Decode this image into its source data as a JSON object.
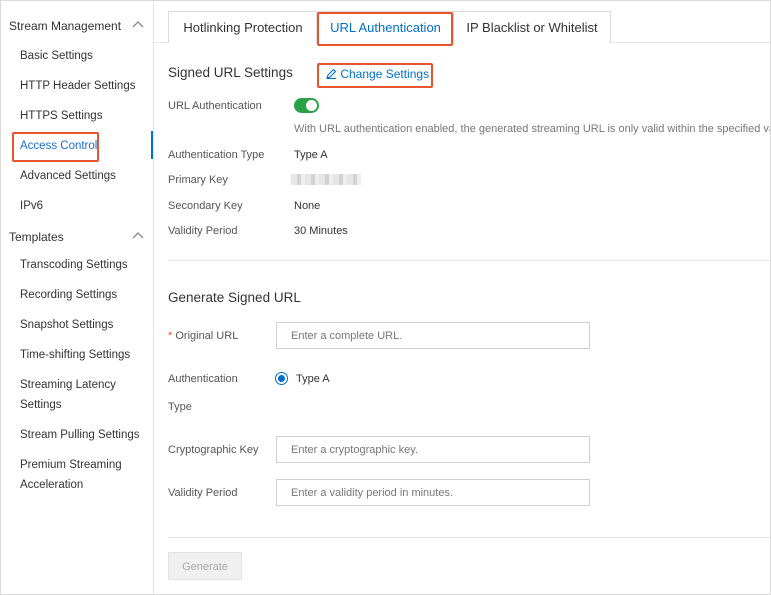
{
  "sidebar": {
    "stream_management": {
      "title": "Stream Management",
      "items": [
        "Basic Settings",
        "HTTP Header Settings",
        "HTTPS Settings",
        "Access Control",
        "Advanced Settings",
        "IPv6"
      ]
    },
    "templates": {
      "title": "Templates",
      "items": [
        "Transcoding Settings",
        "Recording Settings",
        "Snapshot Settings",
        "Time-shifting Settings",
        "Streaming Latency",
        "Settings",
        "Stream Pulling Settings",
        "Premium Streaming",
        "Acceleration"
      ]
    },
    "active_item": "Access Control"
  },
  "tabs": [
    {
      "label": "Hotlinking Protection",
      "active": false
    },
    {
      "label": "URL Authentication",
      "active": true
    },
    {
      "label": "IP Blacklist or Whitelist",
      "active": false
    }
  ],
  "signed_settings": {
    "title": "Signed URL Settings",
    "change_link": "Change Settings",
    "url_auth_label": "URL Authentication",
    "url_auth_enabled": true,
    "description": "With URL authentication enabled, the generated streaming URL is only valid within the specified valid",
    "auth_type_label": "Authentication Type",
    "auth_type_value": "Type A",
    "primary_key_label": "Primary Key",
    "secondary_key_label": "Secondary Key",
    "secondary_key_value": "None",
    "validity_label": "Validity Period",
    "validity_value": "30 Minutes"
  },
  "generate": {
    "title": "Generate Signed URL",
    "required_mark": "*",
    "original_url_label": "Original URL",
    "original_url_placeholder": "Enter a complete URL.",
    "auth_type_label_1": "Authentication",
    "auth_type_label_2": "Type",
    "auth_type_option": "Type A",
    "crypto_key_label": "Cryptographic Key",
    "crypto_key_placeholder": "Enter a cryptographic key.",
    "validity_label": "Validity Period",
    "validity_placeholder": "Enter a validity period in minutes.",
    "button_label": "Generate"
  },
  "colors": {
    "link_blue": "#0070cc",
    "toggle_green": "#2aa148",
    "highlight_orange": "#e8542f"
  }
}
